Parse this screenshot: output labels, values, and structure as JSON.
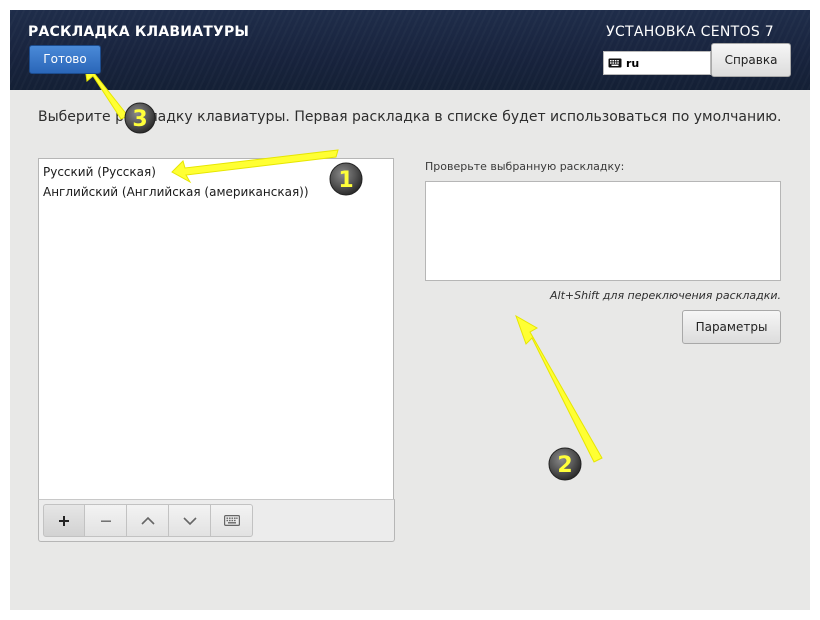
{
  "header": {
    "title": "РАСКЛАДКА КЛАВИАТУРЫ",
    "product": "УСТАНОВКА CENTOS 7",
    "done_label": "Готово",
    "keyboard_indicator": "ru",
    "help_label": "Справка"
  },
  "main": {
    "instructions": "Выберите раскладку клавиатуры. Первая раскладка в списке будет использоваться по умолчанию.",
    "layouts": [
      "Русский (Русская)",
      "Английский (Английская (американская))"
    ],
    "toolbar_icons": [
      "plus-icon",
      "minus-icon",
      "chevron-up-icon",
      "chevron-down-icon",
      "keyboard-icon"
    ],
    "test_label": "Проверьте выбранную раскладку:",
    "test_value": "",
    "switch_hint": "Alt+Shift для переключения раскладки.",
    "options_label": "Параметры"
  },
  "annotations": {
    "badges": [
      "1",
      "2",
      "3"
    ],
    "arrow_color": "#ffff33"
  },
  "colors": {
    "header_bg": "#1b2740",
    "primary_button": "#2f6fc3",
    "window_bg": "#e8e8e7"
  }
}
